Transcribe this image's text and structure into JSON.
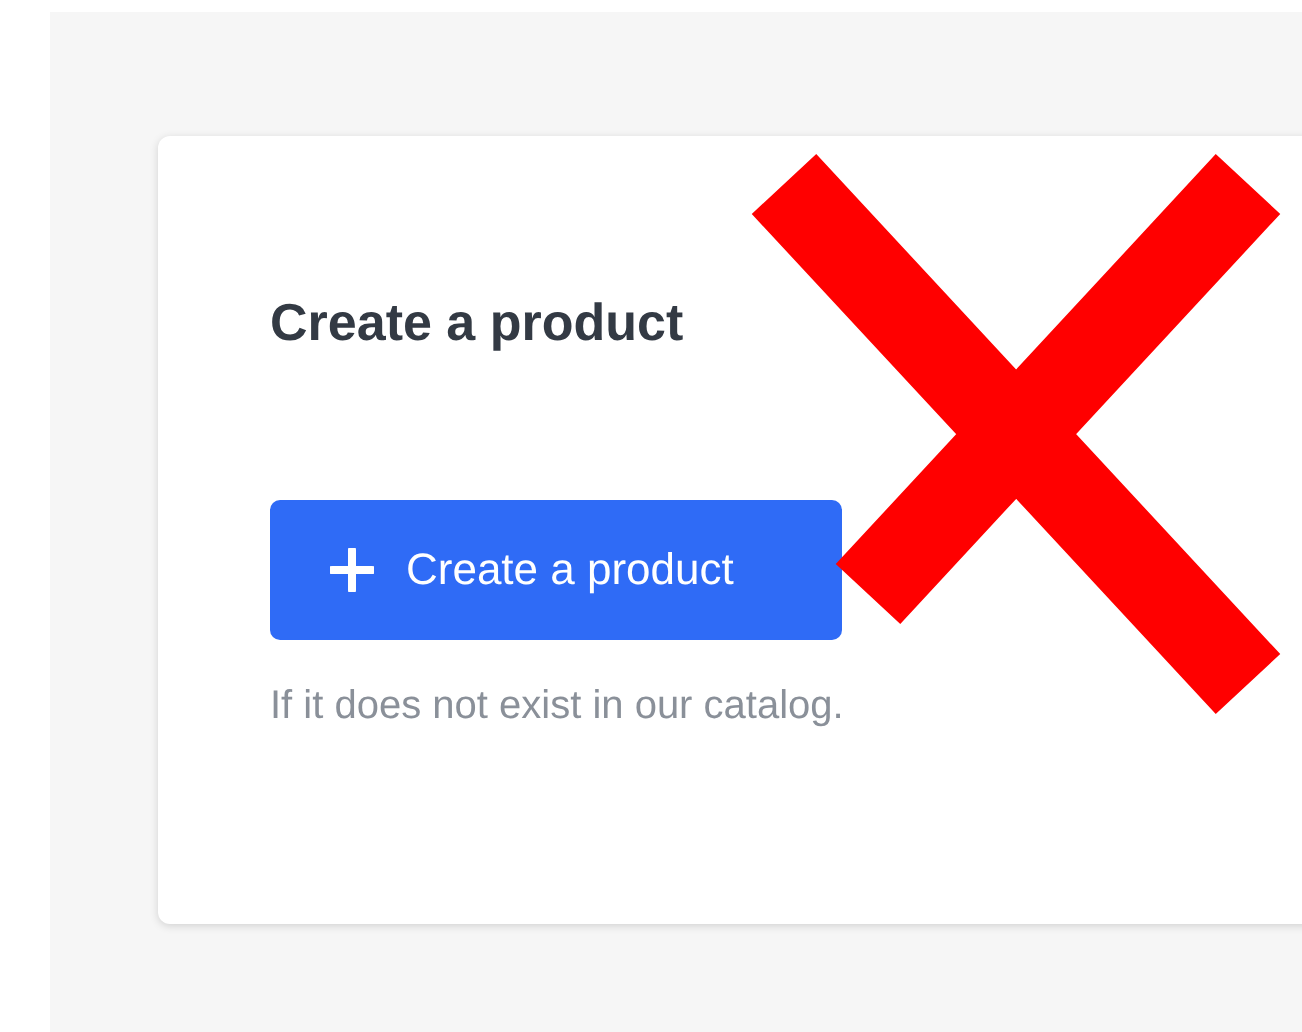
{
  "card": {
    "title": "Create a product",
    "button": {
      "label": "Create a product"
    },
    "hint": "If it does not exist in our catalog."
  },
  "overlay": {
    "kind": "cross"
  }
}
